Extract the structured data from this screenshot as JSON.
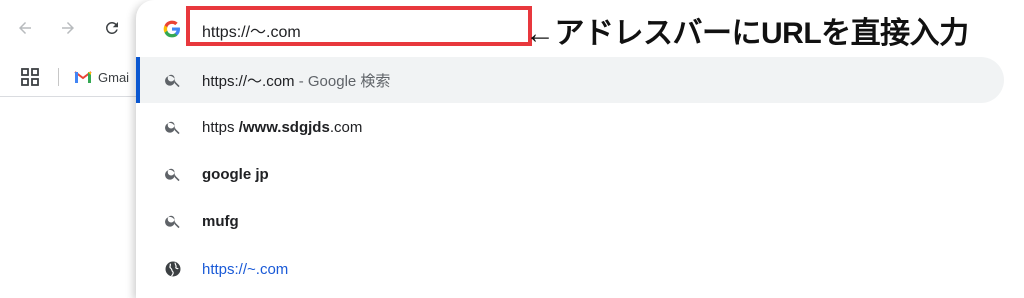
{
  "toolbar": {
    "back_icon": "arrow-left-icon",
    "forward_icon": "arrow-right-icon",
    "reload_icon": "reload-icon"
  },
  "bookmarks": {
    "apps_icon": "apps-grid-icon",
    "items": [
      {
        "label": "Gmai",
        "icon": "gmail-icon"
      }
    ]
  },
  "omnibox": {
    "value": "https://〜.com",
    "engine_icon": "google-g-icon"
  },
  "annotation": {
    "text": "←アドレスバーにURLを直接入力",
    "highlight_color": "#e8383d"
  },
  "suggestions": [
    {
      "icon": "search-icon",
      "text": "https://〜.com",
      "separator": " - ",
      "suffix": "Google 検索",
      "selected": true
    },
    {
      "icon": "search-icon",
      "prefix": "https ",
      "bold": "/www.sdgjds",
      "tail": ".com"
    },
    {
      "icon": "search-icon",
      "prefix": "",
      "bold": "google jp",
      "tail": ""
    },
    {
      "icon": "search-icon",
      "prefix": "",
      "bold": "mufg",
      "tail": ""
    },
    {
      "icon": "globe-icon",
      "url": "https://~.com"
    }
  ],
  "colors": {
    "selection_bar": "#0b57d0",
    "selected_bg": "#f1f3f4",
    "link": "#1a5ad7"
  }
}
